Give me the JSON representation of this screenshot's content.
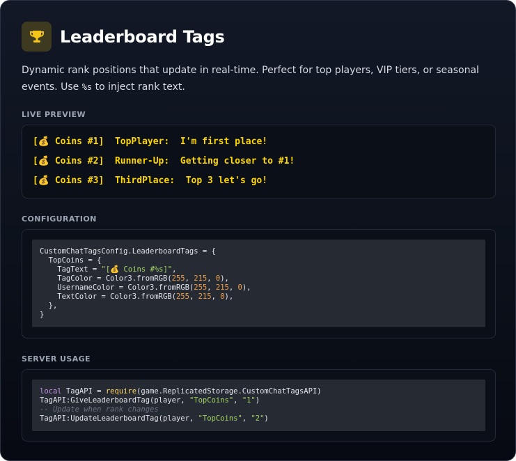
{
  "header": {
    "icon": "trophy-icon",
    "title": "Leaderboard Tags"
  },
  "description": {
    "before": "Dynamic rank positions that update in real-time. Perfect for top players, VIP tiers, or seasonal events. Use ",
    "code": "%s",
    "after": " to inject rank text."
  },
  "preview": {
    "label": "LIVE PREVIEW",
    "tag_color": "#ffd700",
    "lines": [
      {
        "tag": "[💰 Coins #1]",
        "user": "TopPlayer:",
        "message": "I'm first place!"
      },
      {
        "tag": "[💰 Coins #2]",
        "user": "Runner-Up:",
        "message": "Getting closer to #1!"
      },
      {
        "tag": "[💰 Coins #3]",
        "user": "ThirdPlace:",
        "message": "Top 3 let's go!"
      }
    ]
  },
  "configuration": {
    "label": "CONFIGURATION",
    "lines": [
      "CustomChatTagsConfig.LeaderboardTags = {",
      "  TopCoins = {",
      "    TagText = \"[💰 Coins #%s]\",",
      "    TagColor = Color3.fromRGB(255, 215, 0),",
      "    UsernameColor = Color3.fromRGB(255, 215, 0),",
      "    TextColor = Color3.fromRGB(255, 215, 0),",
      "  },",
      "}"
    ]
  },
  "server_usage": {
    "label": "SERVER USAGE",
    "lines": [
      "local TagAPI = require(game.ReplicatedStorage.CustomChatTagsAPI)",
      "TagAPI:GiveLeaderboardTag(player, \"TopCoins\", \"1\")",
      "-- Update when rank changes",
      "TagAPI:UpdateLeaderboardTag(player, \"TopCoins\", \"2\")"
    ]
  }
}
